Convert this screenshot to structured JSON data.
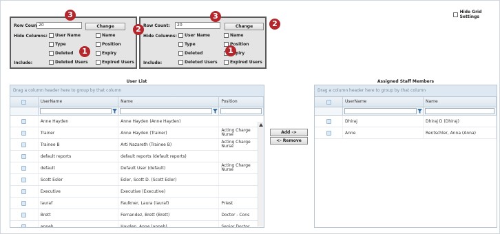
{
  "settings_left": {
    "row_count_label": "Row Count:",
    "row_count_value": "20",
    "change_label": "Change",
    "hide_columns_label": "Hide Columns:",
    "include_label": "Include:",
    "checkboxes": {
      "user_name": "User Name",
      "name": "Name",
      "type": "Type",
      "position": "Position",
      "deleted": "Deleted",
      "expiry": "Expiry",
      "deleted_users": "Deleted Users",
      "expired_users": "Expired Users"
    }
  },
  "settings_right": {
    "row_count_label": "Row Count:",
    "row_count_value": "20",
    "change_label": "Change",
    "hide_columns_label": "Hide Columns:",
    "include_label": "Include:",
    "checkboxes": {
      "user_name": "User Name",
      "name": "Name",
      "type": "Type",
      "position": "Position",
      "deleted": "Deleted",
      "expiry": "Expiry",
      "deleted_users": "Deleted Users",
      "expired_users": "Expired Users"
    }
  },
  "badges": {
    "one": "1",
    "two": "2",
    "three": "3"
  },
  "hide_grid_settings": "Hide Grid Settings",
  "user_list": {
    "title": "User List",
    "group_hint": "Drag a column header here to group by that column",
    "columns": [
      "UserName",
      "Name",
      "Position"
    ],
    "rows": [
      [
        "Anne Hayden",
        "Anne Hayden (Anne Hayden)",
        ""
      ],
      [
        "Trainer",
        "Anne Hayden (Trainer)",
        "Acting Charge Nurse"
      ],
      [
        "Trainee B",
        "Arti Nazareth (Trainee B)",
        "Acting Charge Nurse"
      ],
      [
        "default reports",
        "default reports (default reports)",
        ""
      ],
      [
        "default",
        "Default User (default)",
        "Acting Charge Nurse"
      ],
      [
        "Scott Esler",
        "Esler, Scott D. (Scott Esler)",
        ""
      ],
      [
        "Executive",
        "Executive (Executive)",
        ""
      ],
      [
        "lauraf",
        "Faulkner, Laura (lauraf)",
        "Priest"
      ],
      [
        "Brett",
        "Fernandez, Brett (Brett)",
        "Doctor - Cons"
      ],
      [
        "anneh",
        "Hayden, Anne (anneh)",
        "Senior Doctor"
      ]
    ]
  },
  "buttons": {
    "add": "Add ->",
    "remove": "<- Remove"
  },
  "assigned": {
    "title": "Assigned Staff Members",
    "group_hint": "Drag a column header here to group by that column",
    "columns": [
      "UserName",
      "Name"
    ],
    "rows": [
      [
        "Dhiraj",
        "Dhiraj D (Dhiraj)"
      ],
      [
        "Anne",
        "Rentschler, Anna (Anna)"
      ]
    ]
  }
}
